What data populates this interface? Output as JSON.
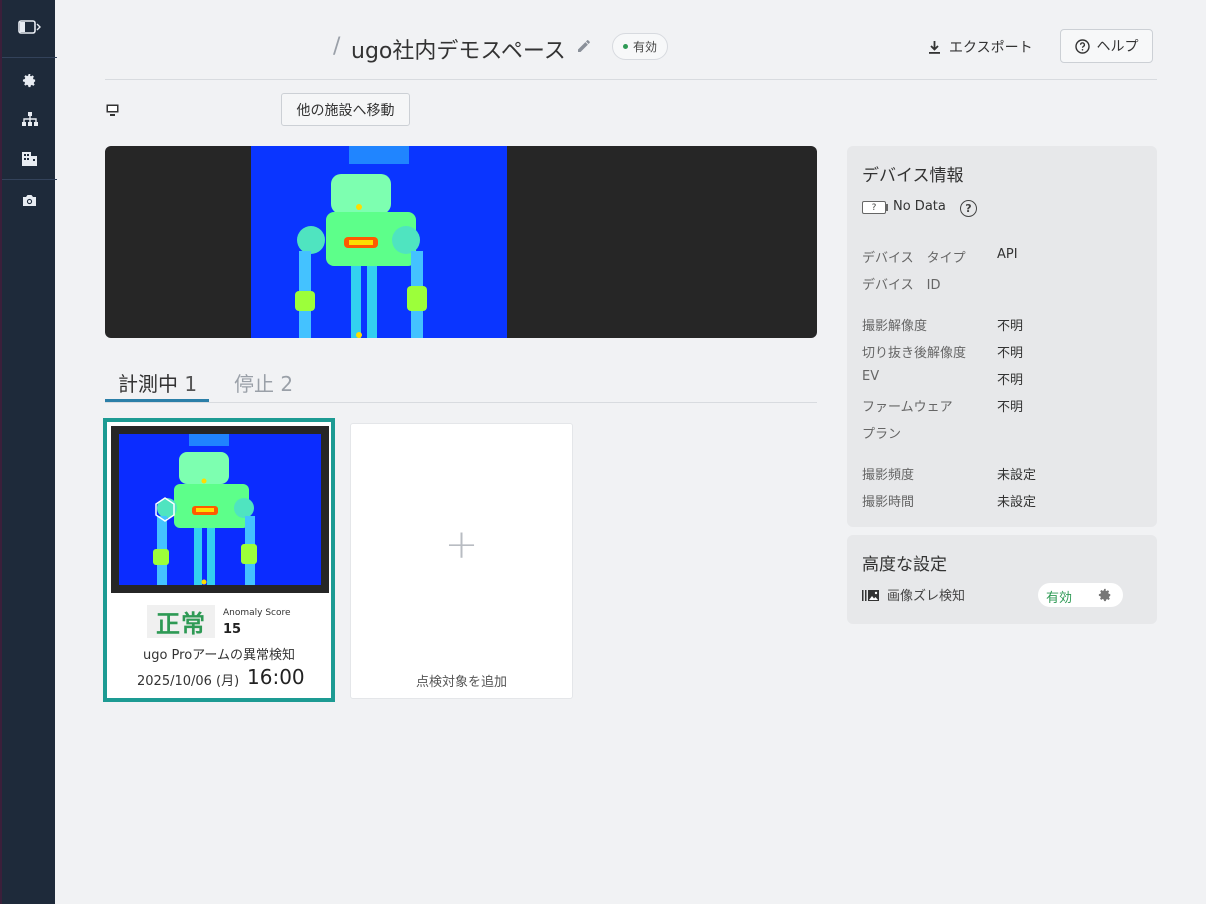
{
  "header": {
    "separator": "/",
    "title": "ugo社内デモスペース",
    "status": "有効",
    "export_label": "エクスポート",
    "help_label": "ヘルプ"
  },
  "toolbar": {
    "move_label": "他の施設へ移動"
  },
  "tabs": [
    {
      "label": "計測中",
      "count": "1"
    },
    {
      "label": "停止",
      "count": "2"
    }
  ],
  "card": {
    "status": "正常",
    "score_label": "Anomaly Score",
    "score": "15",
    "name": "ugo Proアームの異常検知",
    "date": "2025/10/06 (月)",
    "time": "16:00"
  },
  "add_card": {
    "plus": "+",
    "label": "点検対象を追加"
  },
  "device_info": {
    "title": "デバイス情報",
    "battery_symbol": "?",
    "battery_text": "No Data",
    "help_symbol": "?",
    "rows": [
      {
        "key": "デバイス　タイプ",
        "value": "API"
      },
      {
        "key": "デバイス　ID",
        "value": ""
      },
      {
        "key": "撮影解像度",
        "value": "不明"
      },
      {
        "key": "切り抜き後解像度",
        "value": "不明"
      },
      {
        "key": "EV",
        "value": "不明"
      },
      {
        "key": "ファームウェア",
        "value": "不明"
      },
      {
        "key": "プラン",
        "value": ""
      },
      {
        "key": "撮影頻度",
        "value": "未設定"
      },
      {
        "key": "撮影時間",
        "value": "未設定"
      }
    ]
  },
  "advanced": {
    "title": "高度な設定",
    "item_label": "画像ズレ検知",
    "item_status": "有効"
  },
  "colors": {
    "sidebar": "#1e2a3a",
    "accent_teal": "#1d9b93",
    "tab_underline": "#2b7fa8",
    "ok_green": "#2e9a55"
  },
  "icons": [
    "sidebar-toggle-icon",
    "gear-icon",
    "sitemap-icon",
    "building-icon",
    "camera-icon",
    "pencil-icon",
    "download-icon",
    "help-circle-icon",
    "monitor-icon",
    "battery-icon",
    "image-icon"
  ]
}
